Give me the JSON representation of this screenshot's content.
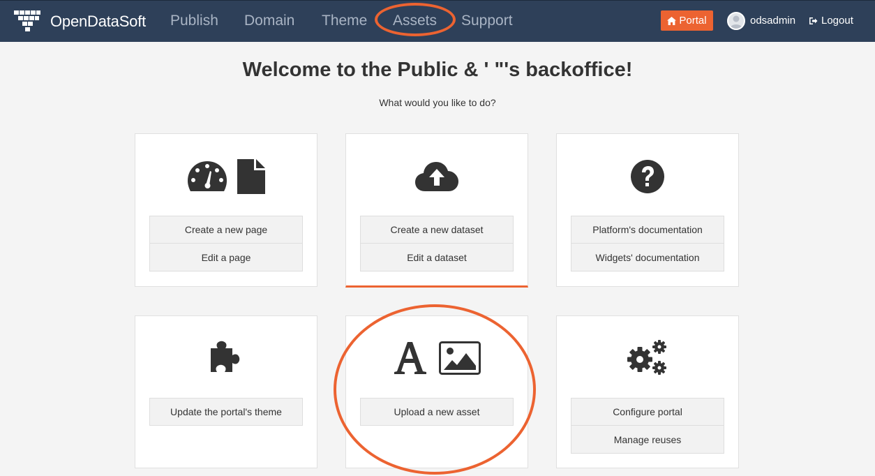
{
  "header": {
    "brand": "OpenDataSoft",
    "nav": {
      "publish": "Publish",
      "domain": "Domain",
      "theme": "Theme",
      "assets": "Assets",
      "support": "Support"
    },
    "portal_label": "Portal",
    "username": "odsadmin",
    "logout_label": "Logout"
  },
  "main": {
    "title": "Welcome to the Public & ' \"'s backoffice!",
    "subtitle": "What would you like to do?"
  },
  "cards": {
    "pages": {
      "icons": [
        "dashboard-icon",
        "file-icon"
      ],
      "buttons": [
        "Create a new page",
        "Edit a page"
      ]
    },
    "datasets": {
      "icons": [
        "cloud-upload-icon"
      ],
      "buttons": [
        "Create a new dataset",
        "Edit a dataset"
      ]
    },
    "docs": {
      "icons": [
        "question-circle-icon"
      ],
      "buttons": [
        "Platform's documentation",
        "Widgets' documentation"
      ]
    },
    "theme": {
      "icons": [
        "puzzle-icon"
      ],
      "buttons": [
        "Update the portal's theme"
      ]
    },
    "assets": {
      "icons": [
        "font-icon",
        "picture-icon"
      ],
      "buttons": [
        "Upload a new asset"
      ]
    },
    "config": {
      "icons": [
        "gears-icon"
      ],
      "buttons": [
        "Configure portal",
        "Manage reuses"
      ]
    }
  },
  "colors": {
    "navbar": "#2e4059",
    "accent": "#ec6331",
    "background": "#f4f4f4"
  }
}
